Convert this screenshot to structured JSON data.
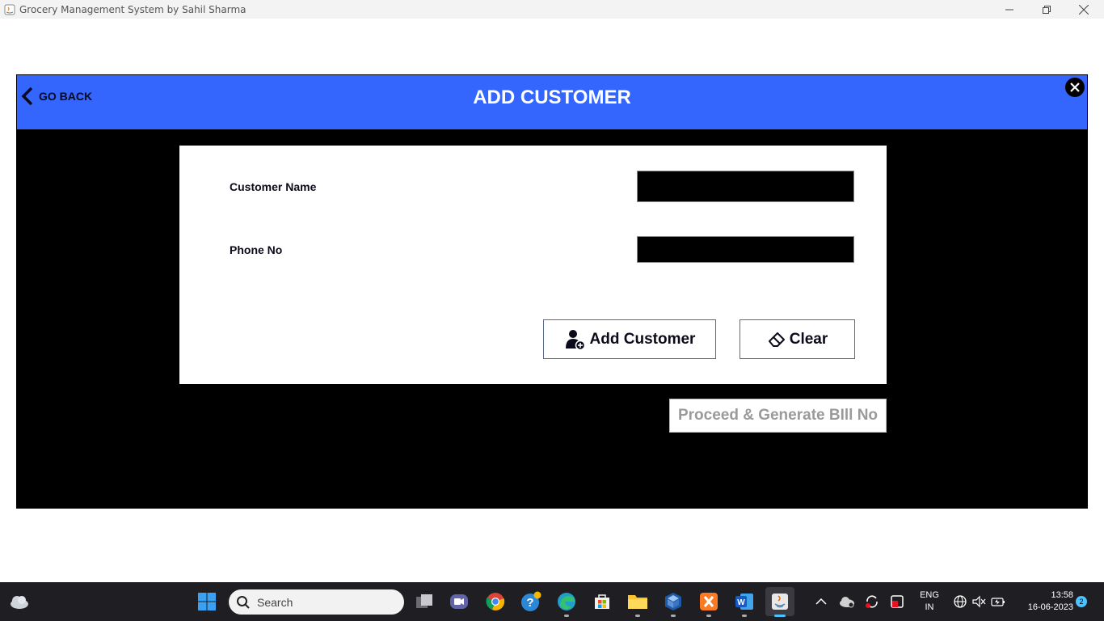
{
  "window": {
    "title": "Grocery Management System by Sahil Sharma"
  },
  "header": {
    "go_back_label": "GO BACK",
    "title": "ADD CUSTOMER",
    "color": "#3465fd"
  },
  "form": {
    "customer_name_label": "Customer Name",
    "customer_name_value": "",
    "phone_label": "Phone No",
    "phone_value": ""
  },
  "buttons": {
    "add_customer": "Add Customer",
    "clear": "Clear",
    "proceed": "Proceed & Generate BIll No"
  },
  "taskbar": {
    "search_placeholder": "Search",
    "language_line1": "ENG",
    "language_line2": "IN",
    "time": "13:58",
    "date": "16-06-2023",
    "notification_count": "2"
  }
}
